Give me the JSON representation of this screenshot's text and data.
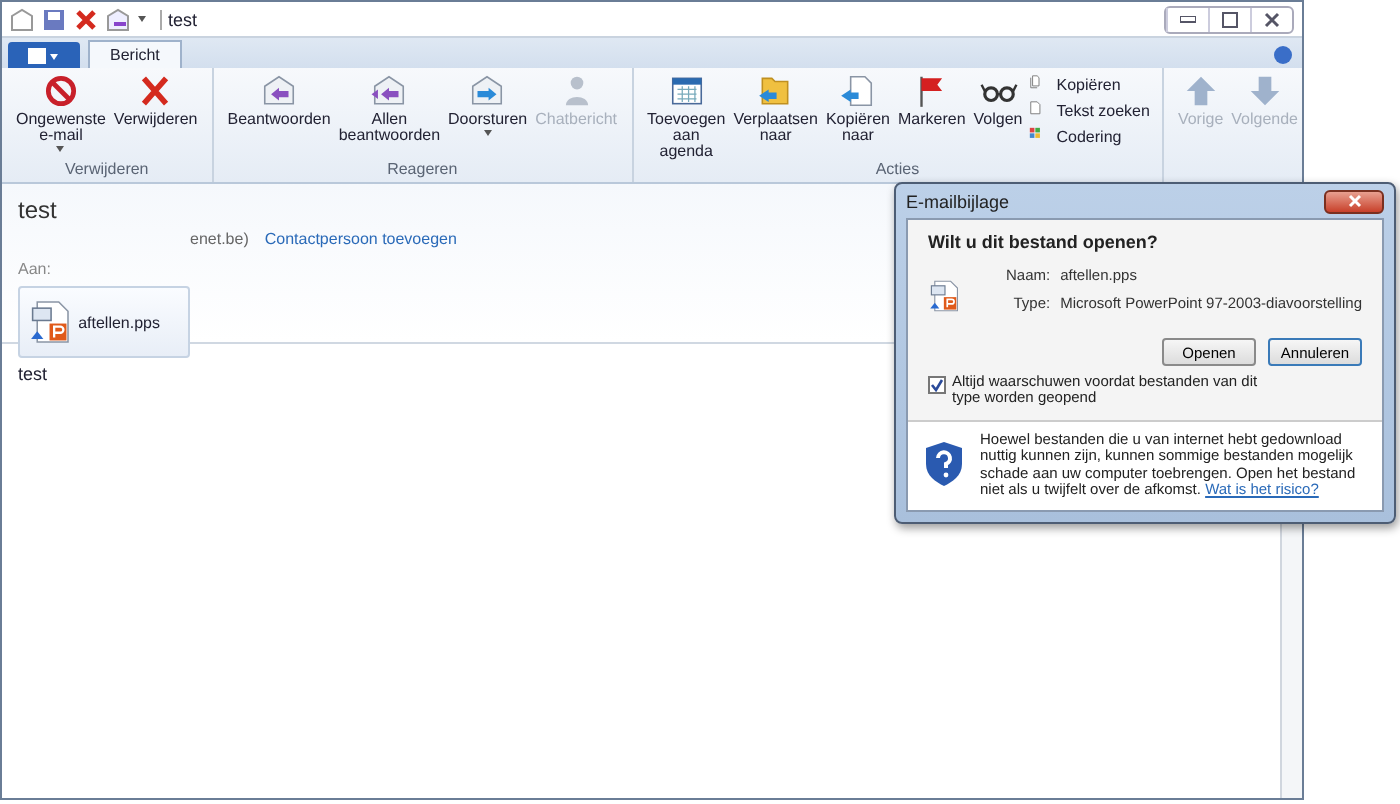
{
  "window": {
    "title": "test"
  },
  "tabs": [
    {
      "label": "Bericht",
      "selected": true
    }
  ],
  "ribbon": [
    {
      "label": "Verwijderen",
      "buttons": [
        {
          "kind": "large",
          "label": "Ongewenste e-mail",
          "dropdown": true,
          "disabled": false
        },
        {
          "kind": "large",
          "label": "Verwijderen",
          "dropdown": false,
          "disabled": false
        }
      ]
    },
    {
      "label": "Reageren",
      "buttons": [
        {
          "kind": "large",
          "label": "Beantwoorden",
          "dropdown": false,
          "disabled": false
        },
        {
          "kind": "large",
          "label": "Allen beantwoorden",
          "dropdown": false,
          "disabled": false
        },
        {
          "kind": "large",
          "label": "Doorsturen",
          "dropdown": true,
          "disabled": false
        },
        {
          "kind": "large",
          "label": "Chatbericht",
          "dropdown": false,
          "disabled": true
        }
      ]
    },
    {
      "label": "Acties",
      "buttons": [
        {
          "kind": "large",
          "label": "Toevoegen aan agenda",
          "dropdown": false,
          "disabled": false
        },
        {
          "kind": "large",
          "label": "Verplaatsen naar",
          "dropdown": false,
          "disabled": false
        },
        {
          "kind": "large",
          "label": "Kopiëren naar",
          "dropdown": false,
          "disabled": false
        },
        {
          "kind": "large",
          "label": "Markeren",
          "dropdown": false,
          "disabled": false
        },
        {
          "kind": "large",
          "label": "Volgen",
          "dropdown": false,
          "disabled": false
        },
        {
          "kind": "small",
          "label": "Kopiëren",
          "dropdown": false,
          "disabled": false
        },
        {
          "kind": "small",
          "label": "Tekst zoeken",
          "dropdown": false,
          "disabled": false
        },
        {
          "kind": "small",
          "label": "Codering",
          "dropdown": false,
          "disabled": false
        }
      ]
    },
    {
      "buttons": [
        {
          "kind": "large",
          "label": "Vorige",
          "dropdown": false,
          "disabled": true
        },
        {
          "kind": "large",
          "label": "Volgende",
          "dropdown": false,
          "disabled": true
        }
      ]
    }
  ],
  "message": {
    "subject": "test",
    "sender": "enet.be)",
    "add_contact": "Contactpersoon toevoegen",
    "to_label": "Aan:",
    "attachment": "aftellen.pps",
    "body": "test"
  },
  "dialog": {
    "title": "E-mailbijlage",
    "question": "Wilt u dit bestand openen?",
    "name_label": "Naam:",
    "name": "aftellen.pps",
    "type_label": "Type:",
    "type": "Microsoft PowerPoint 97-2003-diavoorstelling",
    "buttons": [
      "Openen",
      "Annuleren"
    ],
    "checkbox": {
      "label": "Altijd waarschuwen voordat bestanden van dit type worden geopend",
      "checked": true
    },
    "warning": "Hoewel bestanden die u van internet hebt gedownload nuttig kunnen zijn, kunnen sommige bestanden mogelijk schade aan uw computer toebrengen. Open het bestand niet als u twijfelt over de afkomst.",
    "risk_link": "Wat is het risico?"
  }
}
